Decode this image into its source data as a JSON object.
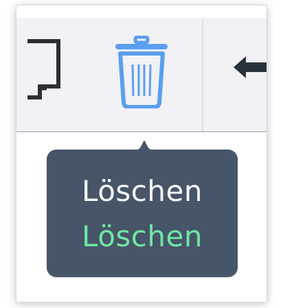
{
  "toolbar": {
    "tools": [
      {
        "icon": "monitor-icon"
      },
      {
        "icon": "trash-icon",
        "color": "#5b9ef0"
      },
      {
        "icon": "arrow-left-icon",
        "color": "#28323b"
      }
    ]
  },
  "tooltip": {
    "primary_text": "Löschen",
    "secondary_text": "Löschen",
    "background": "#475569",
    "primary_color": "#f7f8fa",
    "secondary_color": "#6ee7a2"
  }
}
